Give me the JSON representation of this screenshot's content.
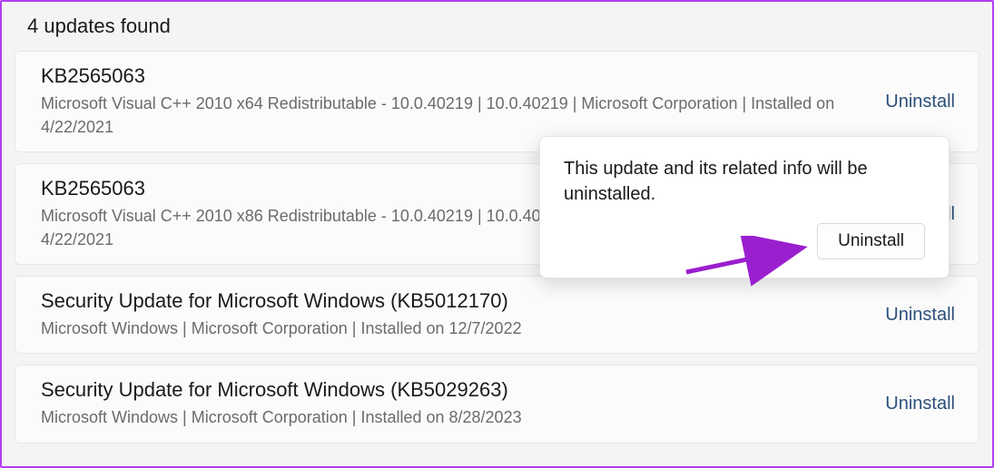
{
  "header": {
    "count_label": "4 updates found"
  },
  "uninstall_label": "Uninstall",
  "updates": [
    {
      "title": "KB2565063",
      "sub": "Microsoft Visual C++ 2010  x64 Redistributable - 10.0.40219  |  10.0.40219  |  Microsoft Corporation  |  Installed on 4/22/2021"
    },
    {
      "title": "KB2565063",
      "sub": "Microsoft Visual C++ 2010  x86 Redistributable - 10.0.40219  |  10.0.40219  |  Microsoft Corporation  |  Installed on 4/22/2021"
    },
    {
      "title": "Security Update for Microsoft Windows (KB5012170)",
      "sub": "Microsoft Windows  |  Microsoft Corporation  |  Installed on 12/7/2022"
    },
    {
      "title": "Security Update for Microsoft Windows (KB5029263)",
      "sub": "Microsoft Windows  |  Microsoft Corporation  |  Installed on 8/28/2023"
    }
  ],
  "popover": {
    "message": "This update and its related info will be uninstalled.",
    "confirm_label": "Uninstall"
  },
  "colors": {
    "accent_border": "#b03ff0",
    "link": "#2b4f7a",
    "arrow": "#9a1fcf"
  }
}
